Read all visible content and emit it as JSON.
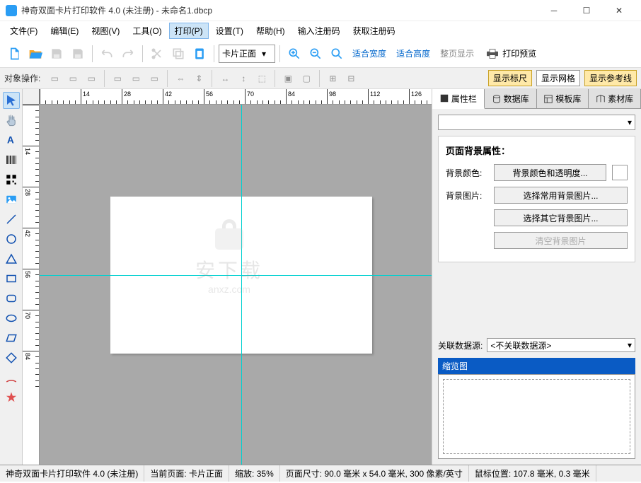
{
  "title": "神奇双面卡片打印软件 4.0 (未注册) - 未命名1.dbcp",
  "menus": [
    "文件(F)",
    "编辑(E)",
    "视图(V)",
    "工具(O)",
    "打印(P)",
    "设置(T)",
    "帮助(H)",
    "输入注册码",
    "获取注册码"
  ],
  "side_select": "卡片正面",
  "fit_width": "适合宽度",
  "fit_height": "适合高度",
  "fit_page": "整页显示",
  "print_preview": "打印预览",
  "ops_label": "对象操作:",
  "toggle_ruler": "显示标尺",
  "toggle_grid": "显示网格",
  "toggle_guides": "显示参考线",
  "tabs": {
    "props": "属性栏",
    "db": "数据库",
    "tpl": "模板库",
    "assets": "素材库"
  },
  "bg_section_title": "页面背景属性：",
  "bg_color_label": "背景颜色:",
  "bg_color_btn": "背景颜色和透明度...",
  "bg_img_label": "背景图片:",
  "bg_img_common": "选择常用背景图片...",
  "bg_img_other": "选择其它背景图片...",
  "bg_img_clear": "清空背景图片",
  "datasrc_label": "关联数据源:",
  "datasrc_value": "<不关联数据源>",
  "thumb_title": "缩览图",
  "status": {
    "app": "神奇双面卡片打印软件 4.0 (未注册)",
    "page_label": "当前页面:",
    "page_value": "卡片正面",
    "zoom_label": "缩放:",
    "zoom_value": "35%",
    "size_label": "页面尺寸:",
    "size_value": "90.0 毫米 x 54.0 毫米, 300 像素/英寸",
    "pos_label": "鼠标位置:",
    "pos_value": "107.8 毫米, 0.3 毫米"
  },
  "ruler_h": [
    {
      "p": 0,
      "l": ""
    },
    {
      "p": 58,
      "l": "14"
    },
    {
      "p": 116,
      "l": "28"
    },
    {
      "p": 174,
      "l": "42"
    },
    {
      "p": 232,
      "l": "56"
    },
    {
      "p": 290,
      "l": "70"
    },
    {
      "p": 348,
      "l": "84"
    },
    {
      "p": 406,
      "l": "98"
    },
    {
      "p": 464,
      "l": "112"
    },
    {
      "p": 522,
      "l": "126"
    }
  ],
  "ruler_v": [
    {
      "p": 0,
      "l": ""
    },
    {
      "p": 58,
      "l": "14"
    },
    {
      "p": 116,
      "l": "28"
    },
    {
      "p": 174,
      "l": "42"
    },
    {
      "p": 232,
      "l": "56"
    },
    {
      "p": 290,
      "l": "70"
    },
    {
      "p": 348,
      "l": "84"
    }
  ]
}
